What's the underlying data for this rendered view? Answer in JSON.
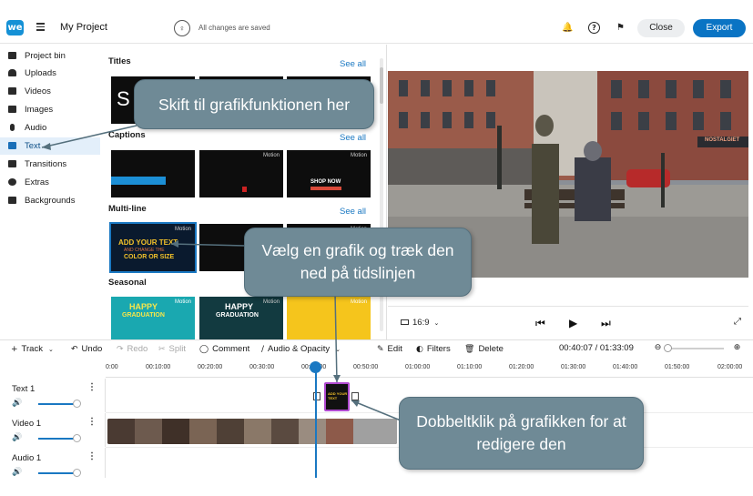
{
  "header": {
    "logo_text": "we",
    "project_title": "My Project",
    "save_status": "All changes are saved",
    "close_label": "Close",
    "export_label": "Export",
    "export_color": "#0a74c4"
  },
  "sidebar": {
    "items": [
      {
        "label": "Project bin",
        "icon": "folder-icon"
      },
      {
        "label": "Uploads",
        "icon": "cloud-upload-icon"
      },
      {
        "label": "Videos",
        "icon": "video-icon"
      },
      {
        "label": "Images",
        "icon": "image-icon"
      },
      {
        "label": "Audio",
        "icon": "music-note-icon"
      },
      {
        "label": "Text",
        "icon": "text-icon",
        "active": true
      },
      {
        "label": "Transitions",
        "icon": "transition-icon"
      },
      {
        "label": "Extras",
        "icon": "emoji-icon"
      },
      {
        "label": "Backgrounds",
        "icon": "backgrounds-icon"
      }
    ]
  },
  "library": {
    "see_all": "See all",
    "sections": [
      {
        "title": "Titles"
      },
      {
        "title": "Captions"
      },
      {
        "title": "Multi-line"
      },
      {
        "title": "Seasonal"
      }
    ],
    "motion_badge": "Motion",
    "thumb_texts": {
      "shop_now": "SHOP NOW",
      "add_your_text": "ADD YOUR TEXT",
      "change_the": "AND CHANGE THE",
      "color_or_size": "COLOR OR SIZE",
      "happy": "HAPPY",
      "graduation": "GRADUATION"
    }
  },
  "preview": {
    "aspect_ratio": "16:9",
    "storefront_sign": "NOSTALGIET"
  },
  "timeline_toolbar": {
    "track": "Track",
    "undo": "Undo",
    "redo": "Redo",
    "split": "Split",
    "comment": "Comment",
    "audio_opacity": "Audio & Opacity",
    "edit": "Edit",
    "filters": "Filters",
    "delete": "Delete",
    "timecode": "00:40:07 / 01:33:09"
  },
  "ruler": [
    "0:00",
    "00:10:00",
    "00:20:00",
    "00:30:00",
    "00:40:00",
    "00:50:00",
    "01:00:00",
    "01:10:00",
    "01:20:00",
    "01:30:00",
    "01:40:00",
    "01:50:00",
    "02:00:00"
  ],
  "tracks": [
    {
      "name": "Text 1"
    },
    {
      "name": "Video 1"
    },
    {
      "name": "Audio 1"
    }
  ],
  "callouts": {
    "text_tab": "Skift til grafikfunktionen her",
    "drag_graphic": "Vælg en grafik og træk den ned på tidslinjen",
    "double_click": "Dobbeltklik på grafikken for at redigere den"
  }
}
